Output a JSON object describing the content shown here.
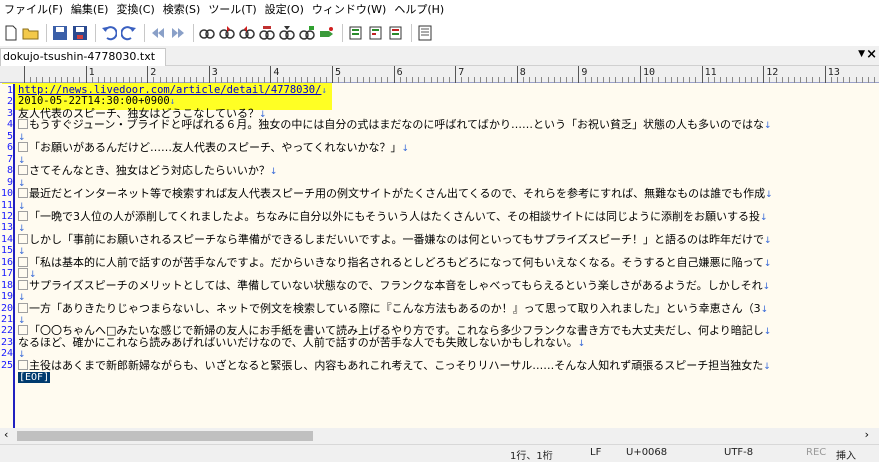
{
  "menu": [
    "ファイル(F)",
    "編集(E)",
    "変換(C)",
    "検索(S)",
    "ツール(T)",
    "設定(O)",
    "ウィンドウ(W)",
    "ヘルプ(H)"
  ],
  "toolbar_icons": [
    "new-file-icon",
    "open-file-icon",
    "save-icon",
    "save-all-icon",
    "undo-icon",
    "redo-icon",
    "back-icon",
    "forward-icon",
    "search-icon",
    "search-next-icon",
    "search-prev-icon",
    "replace-icon",
    "grep-icon",
    "compare-icon",
    "tag-jump-icon",
    "bookmark-set-icon",
    "bookmark-next-icon",
    "bookmark-list-icon",
    "outline-icon"
  ],
  "tab": {
    "filename": "dokujo-tsushin-4778030.txt",
    "dropdown": "▼",
    "close": "×"
  },
  "ruler": [
    "1",
    "2",
    "3",
    "4",
    "5",
    "6",
    "7",
    "8",
    "9",
    "10",
    "11",
    "12",
    "13"
  ],
  "lines": [
    {
      "n": "1",
      "text": "http://news.livedoor.com/article/detail/4778030/",
      "link": true,
      "mono": true,
      "box": false
    },
    {
      "n": "2",
      "text": "2010-05-22T14:30:00+0900",
      "link": false,
      "mono": true,
      "box": false
    },
    {
      "n": "3",
      "text": "友人代表のスピーチ、独女はどうこなしている？",
      "link": false,
      "mono": false,
      "box": false
    },
    {
      "n": "4",
      "text": "もうすぐジューン・ブライドと呼ばれる６月。独女の中には自分の式はまだなのに呼ばれてばかり……という「お祝い貧乏」状態の人も多いのではな",
      "link": false,
      "mono": false,
      "box": true
    },
    {
      "n": "5",
      "text": "",
      "link": false,
      "mono": false,
      "box": false
    },
    {
      "n": "6",
      "text": "「お願いがあるんだけど……友人代表のスピーチ、やってくれないかな？」",
      "link": false,
      "mono": false,
      "box": true
    },
    {
      "n": "7",
      "text": "",
      "link": false,
      "mono": false,
      "box": false
    },
    {
      "n": "8",
      "text": "さてそんなとき、独女はどう対応したらいいか？",
      "link": false,
      "mono": false,
      "box": true
    },
    {
      "n": "9",
      "text": "",
      "link": false,
      "mono": false,
      "box": false
    },
    {
      "n": "10",
      "text": "最近だとインターネット等で検索すれば友人代表スピーチ用の例文サイトがたくさん出てくるので、それらを参考にすれば、無難なものは誰でも作成",
      "link": false,
      "mono": false,
      "box": true
    },
    {
      "n": "11",
      "text": "",
      "link": false,
      "mono": false,
      "box": false
    },
    {
      "n": "12",
      "text": "「一晩で3人位の人が添削してくれましたよ。ちなみに自分以外にもそういう人はたくさんいて、その相談サイトには同じように添削をお願いする投",
      "link": false,
      "mono": false,
      "box": true
    },
    {
      "n": "13",
      "text": "",
      "link": false,
      "mono": false,
      "box": false
    },
    {
      "n": "14",
      "text": "しかし「事前にお願いされるスピーチなら準備ができるしまだいいですよ。一番嫌なのは何といってもサプライズスピーチ！」と語るのは昨年だけで",
      "link": false,
      "mono": false,
      "box": true
    },
    {
      "n": "15",
      "text": "",
      "link": false,
      "mono": false,
      "box": false
    },
    {
      "n": "16",
      "text": "「私は基本的に人前で話すのが苦手なんですよ。だからいきなり指名されるとしどろもどろになって何もいえなくなる。そうすると自己嫌悪に陥って",
      "link": false,
      "mono": false,
      "box": true
    },
    {
      "n": "17",
      "text": "",
      "link": false,
      "mono": false,
      "box": true
    },
    {
      "n": "18",
      "text": "サプライズスピーチのメリットとしては、準備していない状態なので、フランクな本音をしゃべってもらえるという楽しさがあるようだ。しかしそれ",
      "link": false,
      "mono": false,
      "box": true
    },
    {
      "n": "19",
      "text": "",
      "link": false,
      "mono": false,
      "box": false
    },
    {
      "n": "20",
      "text": "一方「ありきたりじゃつまらないし、ネットで例文を検索している際に『こんな方法もあるのか！』って思って取り入れました」という幸恵さん（3",
      "link": false,
      "mono": false,
      "box": true
    },
    {
      "n": "21",
      "text": "",
      "link": false,
      "mono": false,
      "box": false
    },
    {
      "n": "22",
      "text": "「〇〇ちゃんへ□みたいな感じで新婦の友人にお手紙を書いて読み上げるやり方です。これなら多少フランクな書き方でも大丈夫だし、何より暗記し",
      "link": false,
      "mono": false,
      "box": true
    },
    {
      "n": "23",
      "text": "なるほど、確かにこれなら読みあげればいいだけなので、人前で話すのが苦手な人でも失敗しないかもしれない。",
      "link": false,
      "mono": false,
      "box": false
    },
    {
      "n": "24",
      "text": "",
      "link": false,
      "mono": false,
      "box": false
    },
    {
      "n": "25",
      "text": "主役はあくまで新郎新婦ながらも、いざとなると緊張し、内容もあれこれ考えて、こっそりリハーサル……そんな人知れず頑張るスピーチ担当独女た",
      "link": false,
      "mono": false,
      "box": true
    }
  ],
  "eof": "[EOF]",
  "status": {
    "pos": "1行、1桁",
    "newline": "LF",
    "code": "U+0068",
    "encoding": "UTF-8",
    "rec": "REC",
    "mode": "挿入"
  },
  "colors": {
    "highlight": "#ffff00",
    "line_number": "#1a1aff",
    "link": "#0000cc",
    "editor_bg": "#fffbf0"
  }
}
